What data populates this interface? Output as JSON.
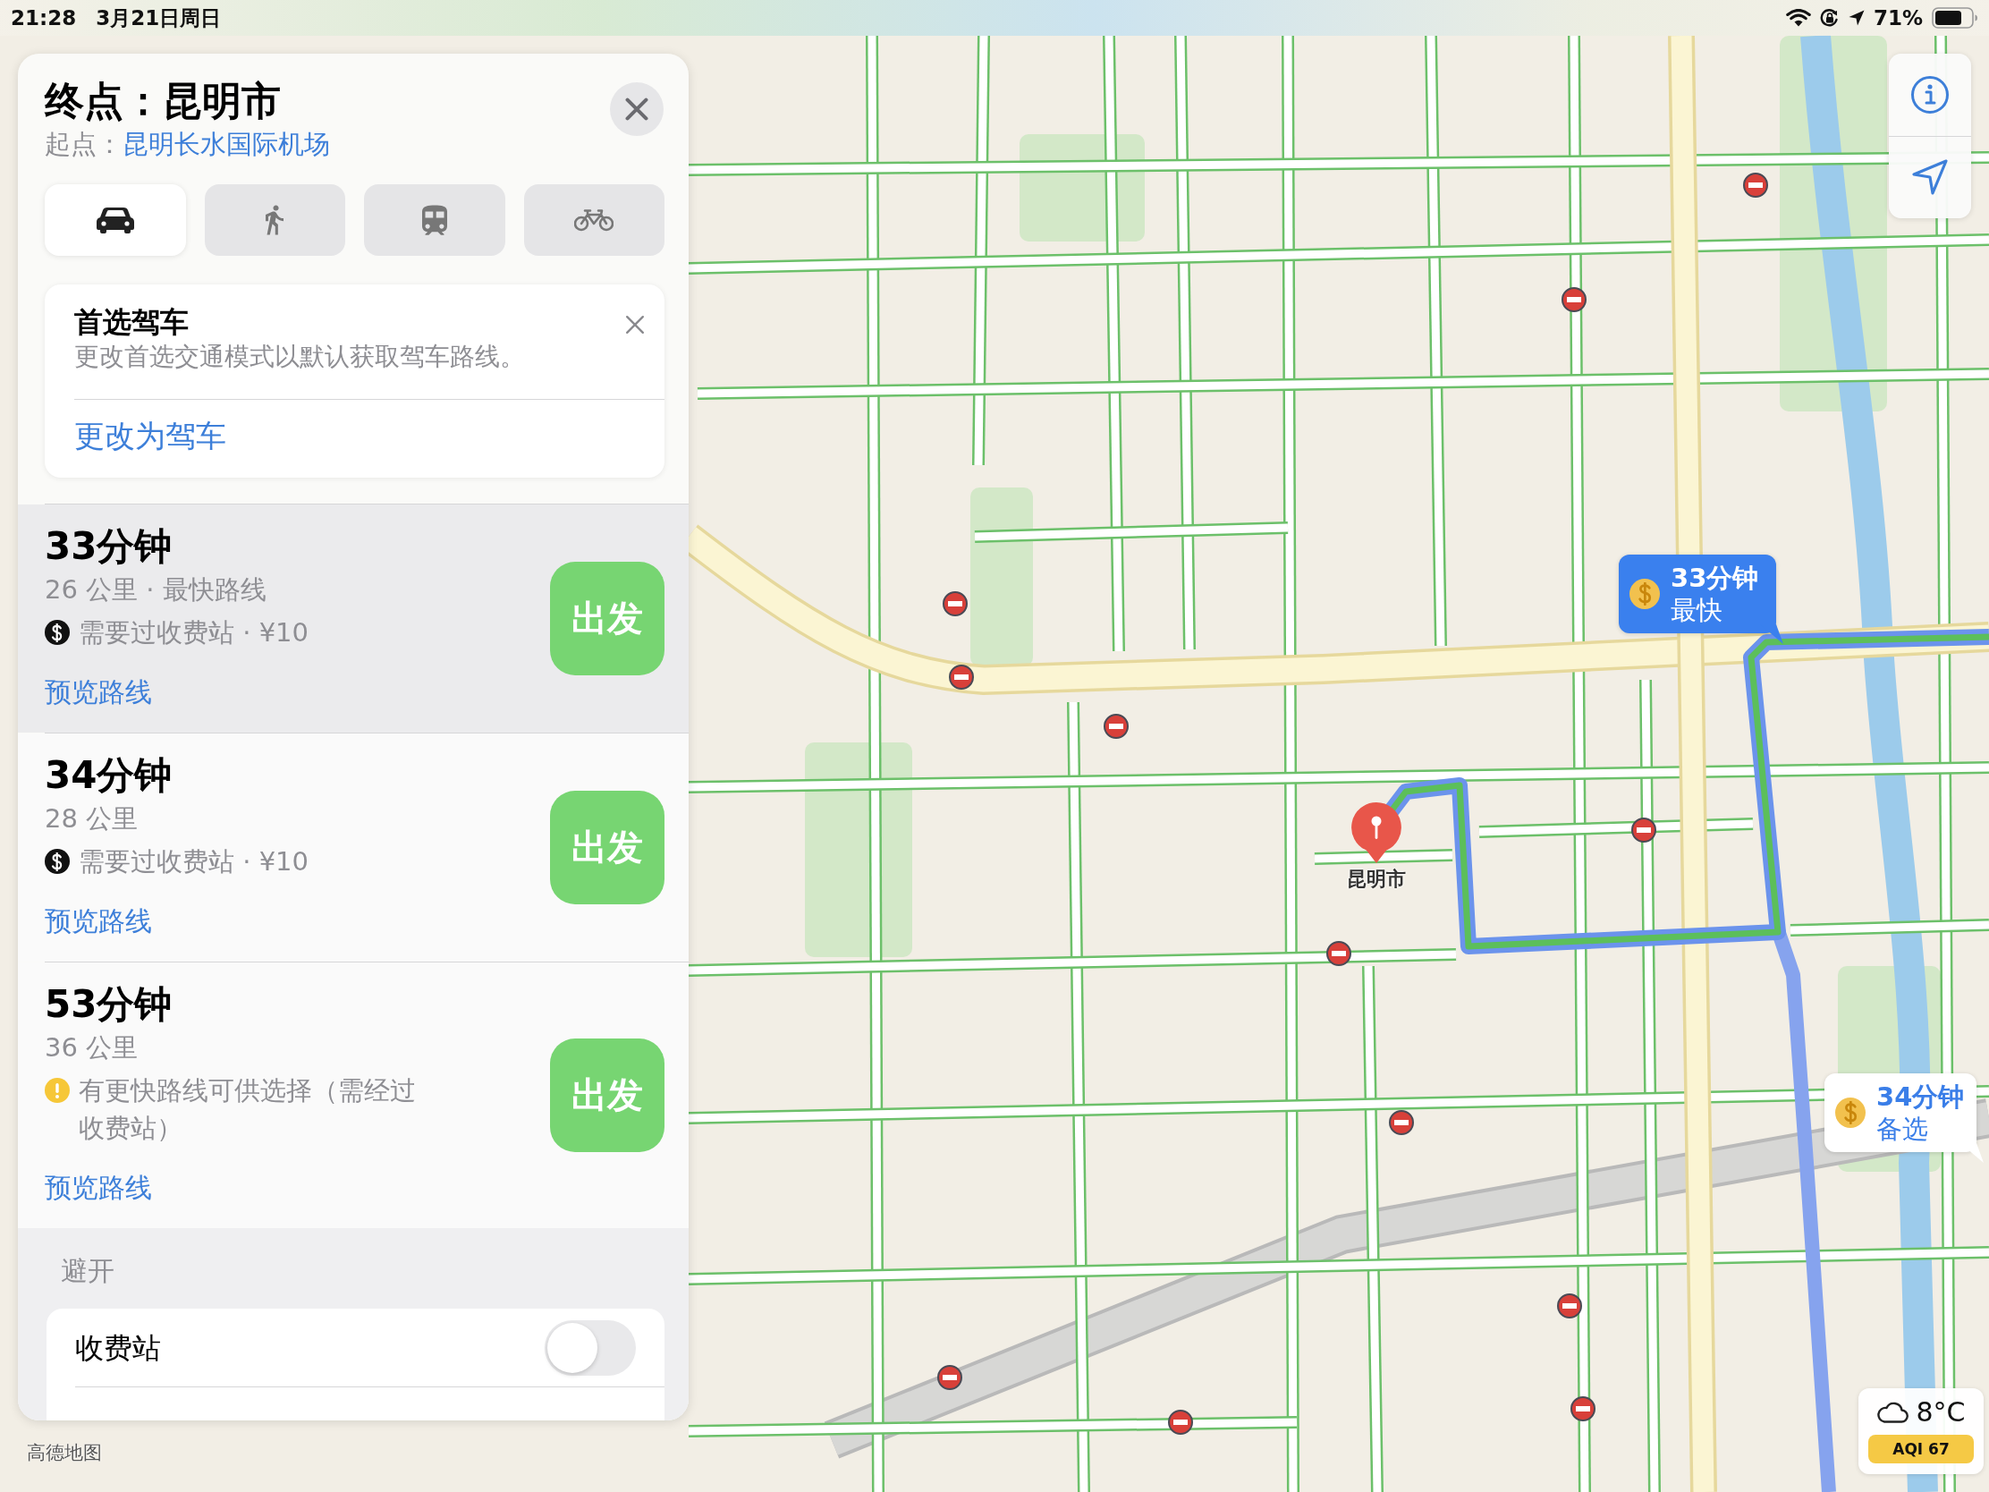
{
  "status_bar": {
    "time": "21:28",
    "date": "3月21日周日",
    "battery": "71%"
  },
  "directions_panel": {
    "title": "终点：昆明市",
    "origin_label": "起点：",
    "origin": "昆明长水国际机场",
    "modes": [
      {
        "kind": "car",
        "selected": true
      },
      {
        "kind": "walk",
        "selected": false
      },
      {
        "kind": "transit",
        "selected": false
      },
      {
        "kind": "bike",
        "selected": false
      }
    ],
    "tip": {
      "title": "首选驾车",
      "text": "更改首选交通模式以默认获取驾车路线。",
      "action": "更改为驾车"
    },
    "routes": [
      {
        "duration": "33分钟",
        "summary": "26 公里 · 最快路线",
        "note": {
          "kind": "toll",
          "text": "需要过收费站 · ¥10"
        },
        "preview": "预览路线",
        "go": "出发",
        "selected": true
      },
      {
        "duration": "34分钟",
        "summary": "28 公里",
        "note": {
          "kind": "toll",
          "text": "需要过收费站 · ¥10"
        },
        "preview": "预览路线",
        "go": "出发",
        "selected": false
      },
      {
        "duration": "53分钟",
        "summary": "36 公里",
        "note": {
          "kind": "warning",
          "text": "有更快路线可供选择（需经过收费站）"
        },
        "preview": "预览路线",
        "go": "出发",
        "selected": false
      }
    ],
    "avoid": {
      "heading": "避开",
      "options": [
        {
          "label": "收费站",
          "on": false
        }
      ]
    }
  },
  "map": {
    "callouts": [
      {
        "kind": "fastest",
        "duration": "33分钟",
        "label": "最快"
      },
      {
        "kind": "alternate",
        "duration": "34分钟",
        "label": "备选"
      }
    ],
    "pin": {
      "label": "昆明市"
    },
    "weather": {
      "temperature": "8°C",
      "aqi": "AQI 67"
    },
    "attribution": "高德地图"
  }
}
